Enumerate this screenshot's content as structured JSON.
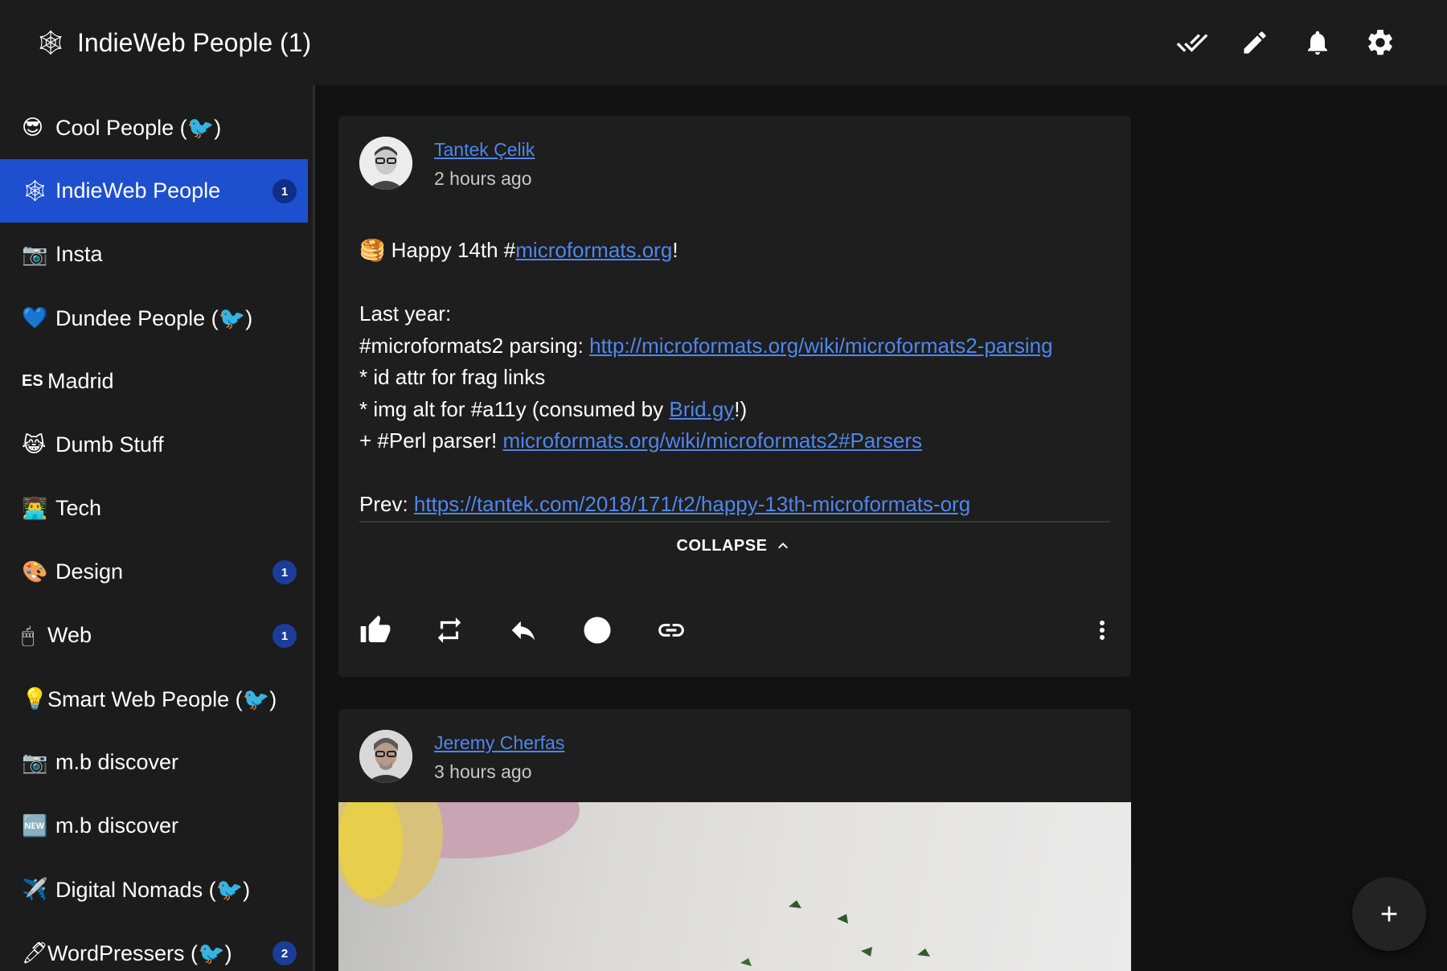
{
  "appbar": {
    "logo": "🕸",
    "title": "IndieWeb People (1)",
    "actions": [
      {
        "icon": "mark-all-read-icon"
      },
      {
        "icon": "pencil-icon"
      },
      {
        "icon": "bell-icon"
      },
      {
        "icon": "gear-icon"
      }
    ]
  },
  "sidebar": {
    "items": [
      {
        "emoji": "😎",
        "label": "Cool People (🐦)",
        "badge": ""
      },
      {
        "emoji": "🕸",
        "label": "IndieWeb People",
        "badge": "1",
        "selected": true
      },
      {
        "emoji": "📷",
        "label": "Insta",
        "badge": ""
      },
      {
        "emoji": "💙",
        "label": "Dundee People (🐦)",
        "badge": ""
      },
      {
        "emoji": "ES",
        "label": "Madrid",
        "badge": ""
      },
      {
        "emoji": "😹",
        "label": "Dumb Stuff",
        "badge": ""
      },
      {
        "emoji": "👨‍💻",
        "label": "Tech",
        "badge": ""
      },
      {
        "emoji": "🎨",
        "label": "Design",
        "badge": "1"
      },
      {
        "emoji": "🖱",
        "label": "Web",
        "badge": "1"
      },
      {
        "emoji": "💡",
        "label": "Smart Web People (🐦)",
        "badge": ""
      },
      {
        "emoji": "📷",
        "label": "m.b discover",
        "badge": ""
      },
      {
        "emoji": "🆕",
        "label": "m.b discover",
        "badge": ""
      },
      {
        "emoji": "✈️",
        "label": "Digital Nomads (🐦)",
        "badge": ""
      },
      {
        "emoji": "🖊",
        "label": "WordPressers (🐦)",
        "badge": "2"
      }
    ]
  },
  "posts": [
    {
      "author": "Tantek Çelik",
      "time": "2 hours ago",
      "line1_prefix": "🥞 Happy 14th #",
      "line1_link": "microformats.org",
      "line1_suffix": "!",
      "line2": "Last year:",
      "line3_prefix": "#microformats2 parsing: ",
      "line3_link": "http://microformats.org/wiki/microformats2-parsing",
      "line4": "* id attr for frag links",
      "line5_prefix": "* img alt for #a11y (consumed by ",
      "line5_link": "Brid.gy",
      "line5_suffix": "!)",
      "line6_prefix": "+ #Perl parser! ",
      "line6_link": "microformats.org/wiki/microformats2#Parsers",
      "line7_prefix": "Prev: ",
      "line7_link": "https://tantek.com/2018/171/t2/happy-13th-microformats-org",
      "collapse_label": "COLLAPSE"
    },
    {
      "author": "Jeremy Cherfas",
      "time": "3 hours ago"
    }
  ],
  "fab": {
    "label": "+"
  }
}
